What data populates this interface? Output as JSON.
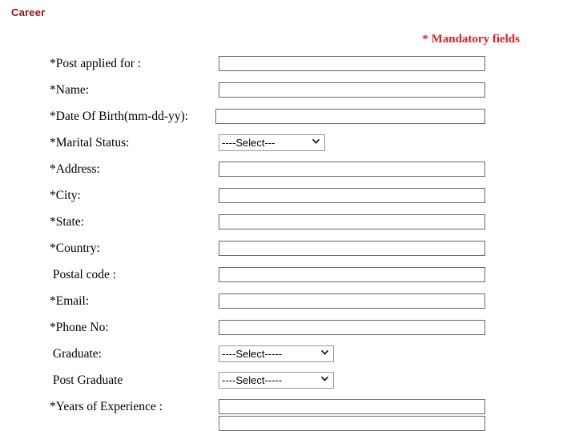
{
  "page": {
    "title": "Career",
    "title_color": "#8c1414",
    "mandatory_note": "* Mandatory fields",
    "mandatory_note_color": "#e02020",
    "background_color": "#ffffff"
  },
  "form": {
    "fields": [
      {
        "label": "*Post applied for :",
        "type": "text",
        "value": "",
        "required": true
      },
      {
        "label": "*Name:",
        "type": "text",
        "value": "",
        "required": true
      },
      {
        "label": "*Date Of Birth(mm-dd-yy):",
        "type": "text",
        "value": "",
        "required": true
      },
      {
        "label": "*Marital Status:",
        "type": "select",
        "value": "----Select---",
        "required": true
      },
      {
        "label": "*Address:",
        "type": "text",
        "value": "",
        "required": true
      },
      {
        "label": "*City:",
        "type": "text",
        "value": "",
        "required": true
      },
      {
        "label": "*State:",
        "type": "text",
        "value": "",
        "required": true
      },
      {
        "label": "*Country:",
        "type": "text",
        "value": "",
        "required": true
      },
      {
        "label": " Postal code :",
        "type": "text",
        "value": "",
        "required": false
      },
      {
        "label": "*Email:",
        "type": "text",
        "value": "",
        "required": true
      },
      {
        "label": "*Phone No:",
        "type": "text",
        "value": "",
        "required": true
      },
      {
        "label": " Graduate:",
        "type": "select",
        "value": "----Select-----",
        "required": false
      },
      {
        "label": " Post Graduate",
        "type": "select",
        "value": "----Select-----",
        "required": false
      },
      {
        "label": "*Years of Experience :",
        "type": "text",
        "value": "",
        "required": true
      }
    ],
    "select_options": {
      "marital_status": [
        "----Select---"
      ],
      "graduate": [
        "----Select-----"
      ],
      "post_graduate": [
        "----Select-----"
      ]
    }
  },
  "icons": {
    "dropdown_chevron": "chevron-down-icon"
  }
}
